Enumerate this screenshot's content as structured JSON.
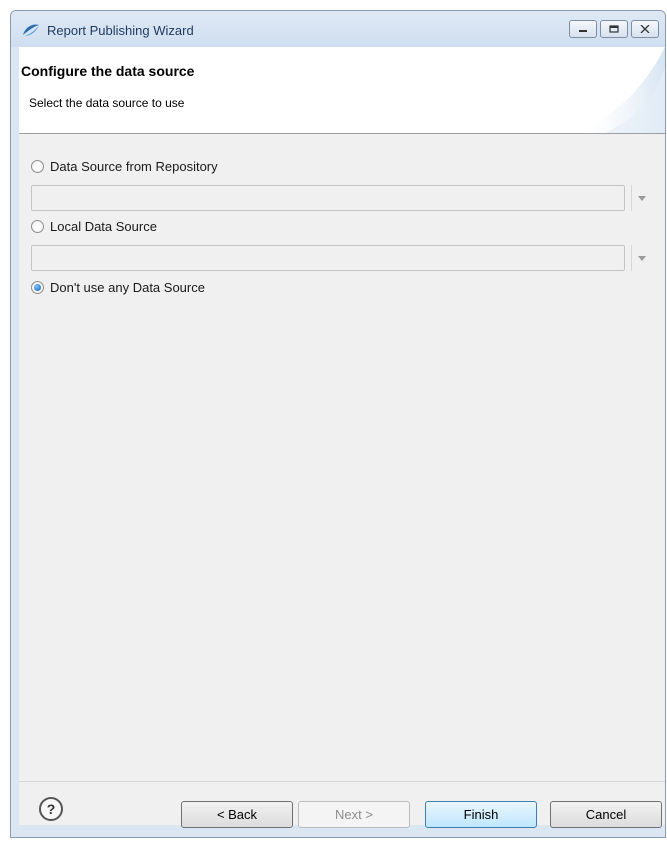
{
  "window": {
    "title": "Report Publishing Wizard",
    "controls": [
      "minimize-icon",
      "maximize-icon",
      "close-icon"
    ]
  },
  "header": {
    "title": "Configure the data source",
    "description": "Select the data source to use"
  },
  "options": [
    {
      "label": "Data Source from Repository",
      "selected": false,
      "has_combo": true,
      "combo_value": ""
    },
    {
      "label": "Local Data Source",
      "selected": false,
      "has_combo": true,
      "combo_value": ""
    },
    {
      "label": "Don't use any Data Source",
      "selected": true,
      "has_combo": false
    }
  ],
  "footer": {
    "help_icon": "help-icon",
    "back_label": "< Back",
    "next_label": "Next >",
    "finish_label": "Finish",
    "cancel_label": "Cancel"
  },
  "colors": {
    "titlebar": "#cfdeef",
    "dialog_bg": "#f0f0f0",
    "default_button": "#bee6fd",
    "radio_selected": "#0f5eb8"
  }
}
